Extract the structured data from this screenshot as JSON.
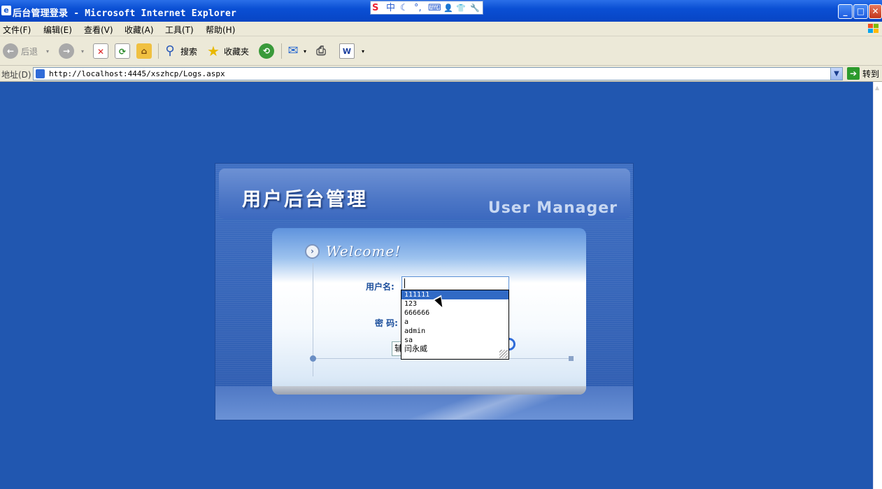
{
  "window": {
    "title": "后台管理登录 - Microsoft Internet Explorer",
    "app_icon": "ie-page-icon",
    "ime_toolbar": [
      "S",
      "中",
      "☾",
      "°,",
      "⌨",
      "👤",
      "👕",
      "🔧"
    ]
  },
  "menubar": {
    "items": [
      {
        "label": "文件(F)"
      },
      {
        "label": "编辑(E)"
      },
      {
        "label": "查看(V)"
      },
      {
        "label": "收藏(A)"
      },
      {
        "label": "工具(T)"
      },
      {
        "label": "帮助(H)"
      }
    ]
  },
  "toolbar": {
    "back_label": "后退",
    "search_label": "搜索",
    "favorites_label": "收藏夹"
  },
  "addressbar": {
    "label": "地址(D)",
    "url": "http://localhost:4445/xszhcp/Logs.aspx",
    "go_label": "转到"
  },
  "login": {
    "title": "用户后台管理",
    "subtitle": "User Manager",
    "welcome": "Welcome!",
    "username_label": "用户名:",
    "password_label": "密 码:",
    "aux_button_label": "辅"
  },
  "autocomplete": {
    "options": [
      "111111",
      "123",
      "666666",
      "a",
      "admin",
      "sa",
      "闫永威"
    ],
    "selected_index": 0
  },
  "colors": {
    "page_background": "#2157b0",
    "selection": "#316ac5",
    "titlebar": "#0a4fd4"
  }
}
